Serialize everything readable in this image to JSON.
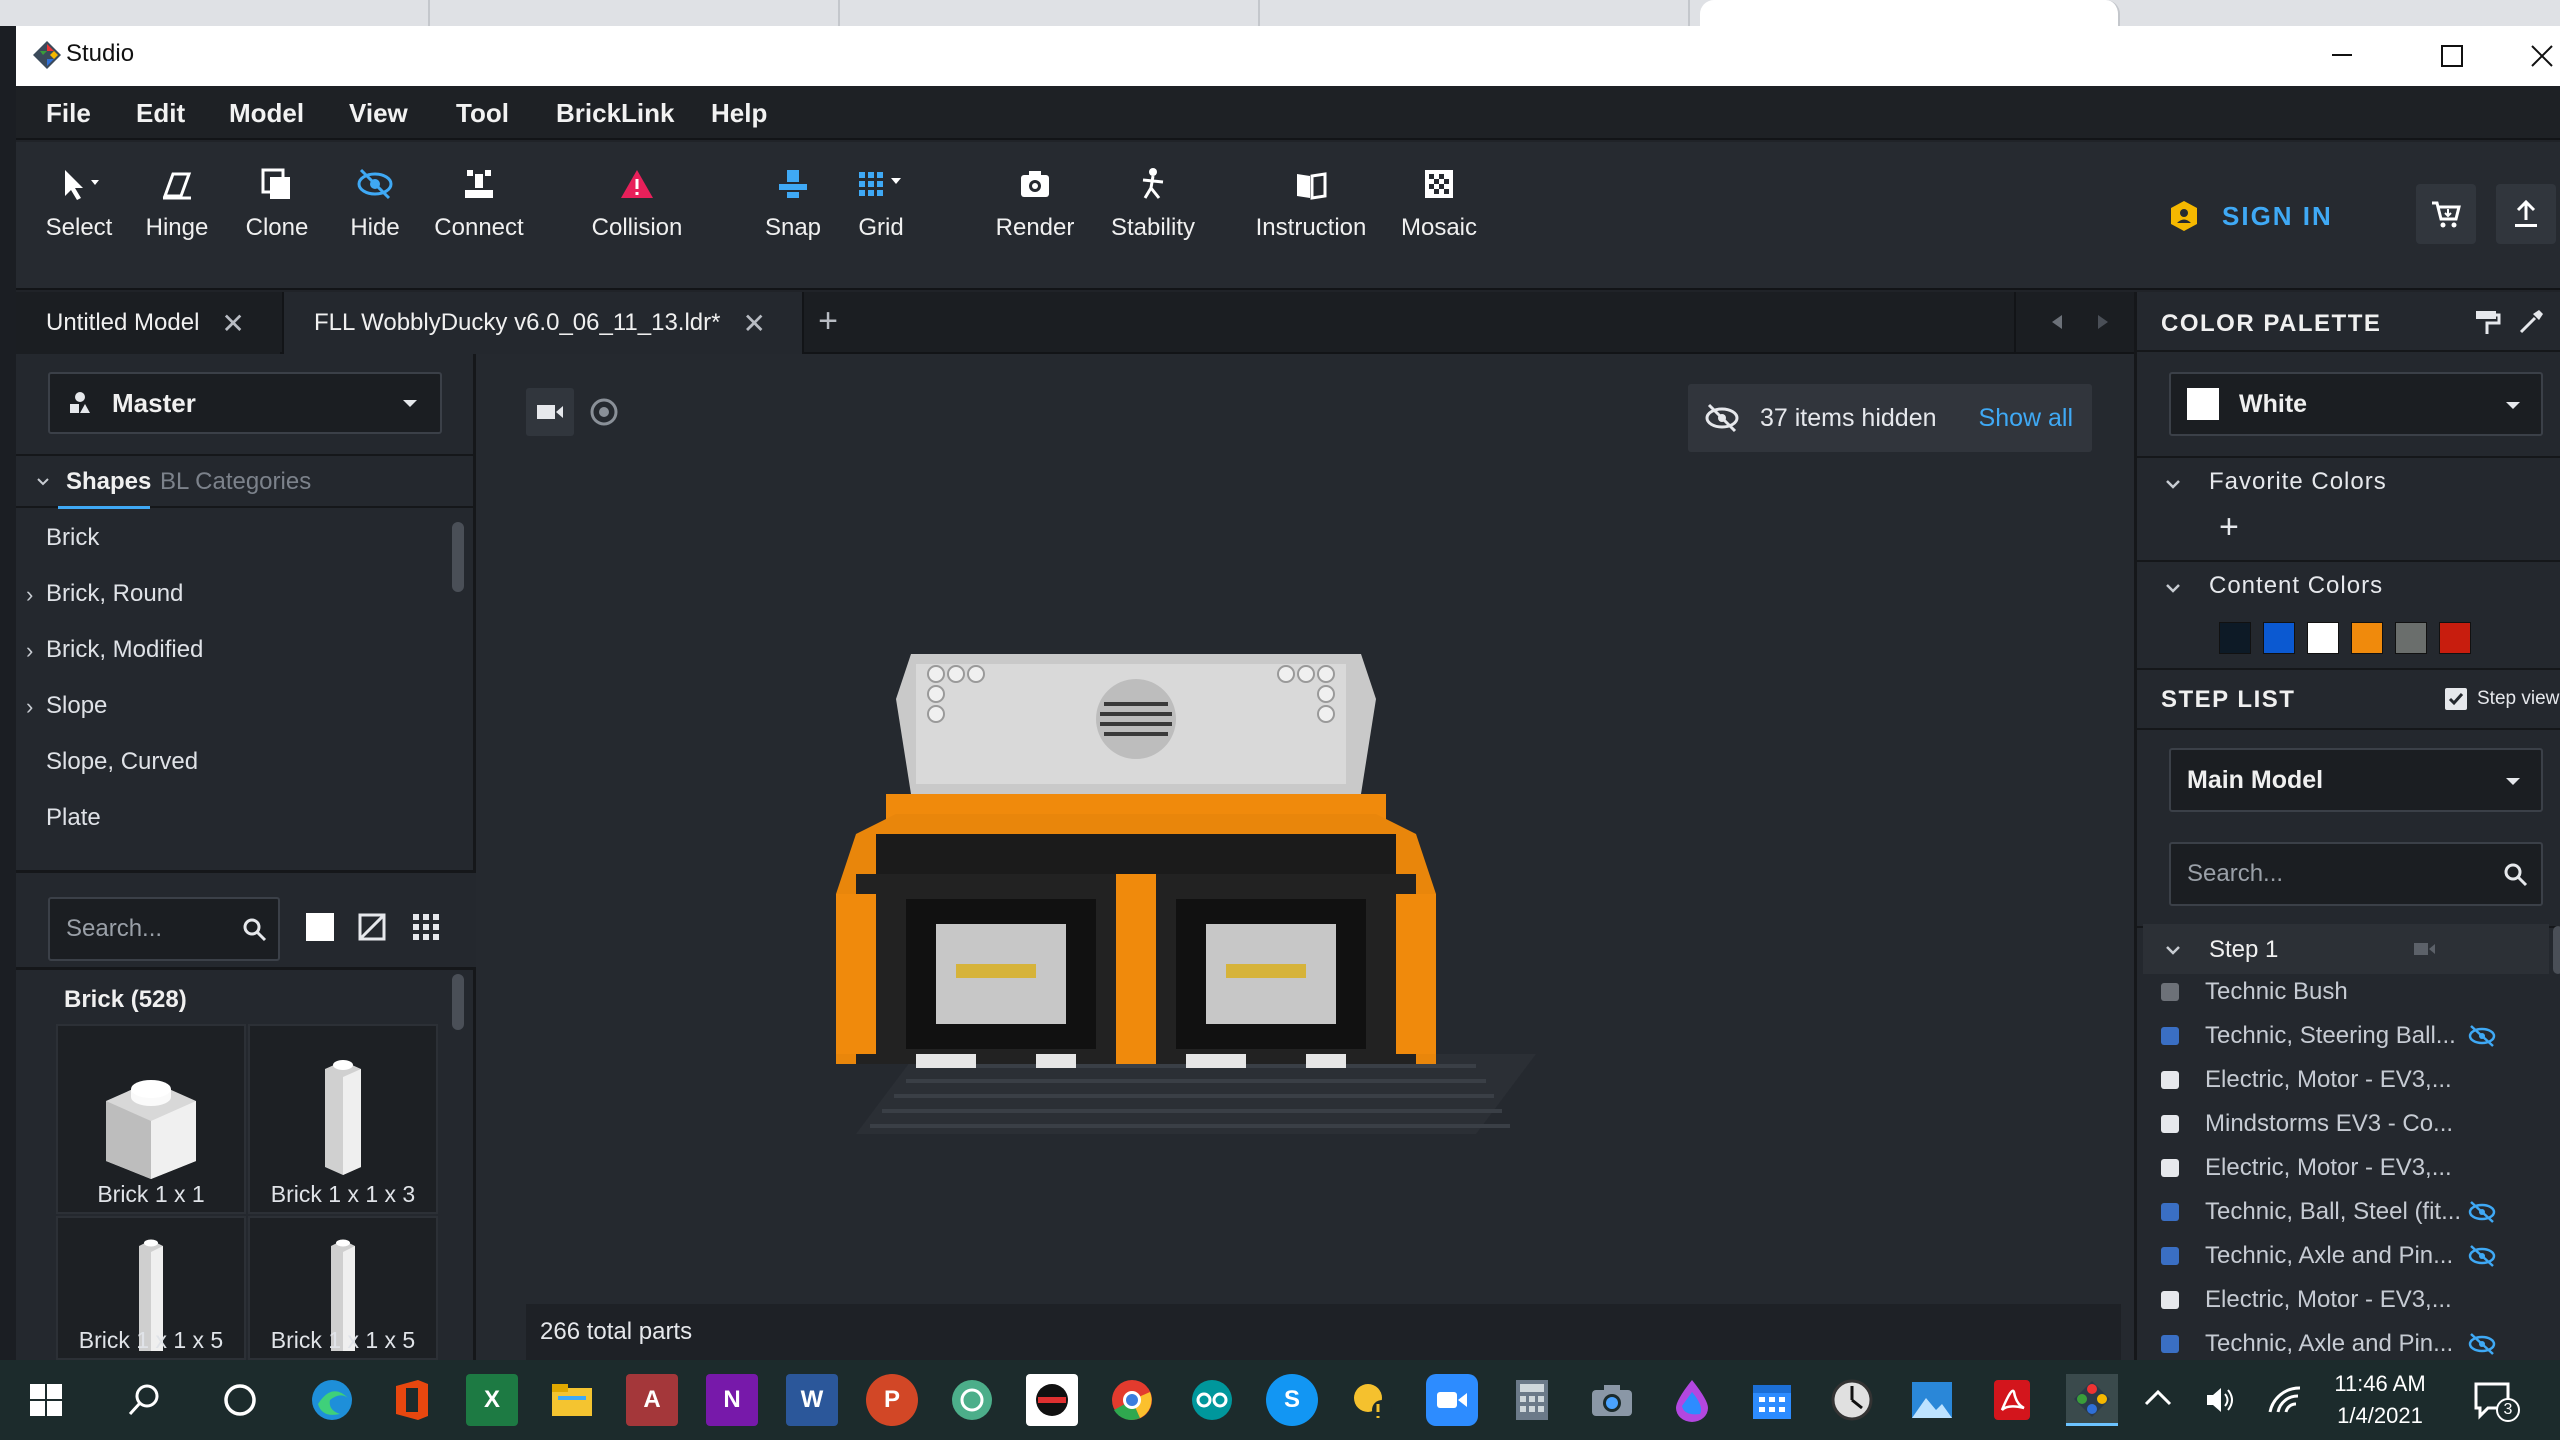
{
  "app": {
    "title": "Studio"
  },
  "menu": [
    "File",
    "Edit",
    "Model",
    "View",
    "Tool",
    "BrickLink",
    "Help"
  ],
  "toolbar": {
    "tools": [
      {
        "label": "Select",
        "icon": "select-arrow-icon"
      },
      {
        "label": "Hinge",
        "icon": "hinge-icon"
      },
      {
        "label": "Clone",
        "icon": "clone-icon"
      },
      {
        "label": "Hide",
        "icon": "hide-eye-icon"
      },
      {
        "label": "Connect",
        "icon": "connect-icon"
      },
      {
        "label": "Collision",
        "icon": "collision-triangle-icon"
      },
      {
        "label": "Snap",
        "icon": "snap-icon"
      },
      {
        "label": "Grid",
        "icon": "grid-icon"
      },
      {
        "label": "Render",
        "icon": "camera-icon"
      },
      {
        "label": "Stability",
        "icon": "stability-icon"
      },
      {
        "label": "Instruction",
        "icon": "instruction-book-icon"
      },
      {
        "label": "Mosaic",
        "icon": "mosaic-icon"
      }
    ],
    "signin": "SIGN IN"
  },
  "tabs": [
    {
      "label": "Untitled Model"
    },
    {
      "label": "FLL WobblyDucky v6.0_06_11_13.ldr*"
    }
  ],
  "left": {
    "master": "Master",
    "shapes_tab": "Shapes",
    "bl_tab": "BL Categories",
    "categories": [
      {
        "label": "Brick",
        "expand": false
      },
      {
        "label": "Brick, Round",
        "expand": true
      },
      {
        "label": "Brick, Modified",
        "expand": true
      },
      {
        "label": "Slope",
        "expand": true
      },
      {
        "label": "Slope, Curved",
        "expand": false
      },
      {
        "label": "Plate",
        "expand": false
      }
    ],
    "search_placeholder": "Search...",
    "group_title": "Brick (528)",
    "parts": [
      "Brick 1 x 1",
      "Brick 1 x 1 x 3",
      "Brick 1 x 1 x 5",
      "Brick 1 x 1 x 5"
    ]
  },
  "viewport": {
    "hidden_text": "37 items hidden",
    "show_all": "Show all",
    "total_parts": "266 total parts"
  },
  "right": {
    "palette_title": "COLOR PALETTE",
    "selected_color": "White",
    "favorite_colors": "Favorite Colors",
    "content_colors": "Content Colors",
    "content_swatches": [
      "#0d1a26",
      "#0b59d1",
      "#ffffff",
      "#f08a0c",
      "#6a6e6c",
      "#c81d0e"
    ],
    "step_list_title": "STEP LIST",
    "step_view": "Step view",
    "model_select": "Main Model",
    "search_placeholder": "Search...",
    "step_label": "Step 1",
    "step_items": [
      {
        "label": "Technic Bush",
        "color": "#6d7178",
        "hidden": false
      },
      {
        "label": "Technic, Steering Ball...",
        "color": "#3a6fc4",
        "hidden": true
      },
      {
        "label": "Electric, Motor - EV3,...",
        "color": "#e6e8ec",
        "hidden": false
      },
      {
        "label": "Mindstorms EV3 - Co...",
        "color": "#e6e8ec",
        "hidden": false
      },
      {
        "label": "Electric, Motor - EV3,...",
        "color": "#e6e8ec",
        "hidden": false
      },
      {
        "label": "Technic, Ball, Steel (fit...",
        "color": "#3a6fc4",
        "hidden": true
      },
      {
        "label": "Technic, Axle and Pin...",
        "color": "#3a6fc4",
        "hidden": true
      },
      {
        "label": "Electric, Motor - EV3,...",
        "color": "#e6e8ec",
        "hidden": false
      },
      {
        "label": "Technic, Axle and Pin...",
        "color": "#3a6fc4",
        "hidden": true
      }
    ]
  },
  "taskbar": {
    "time": "11:46 AM",
    "date": "1/4/2021",
    "notifications": "3"
  }
}
